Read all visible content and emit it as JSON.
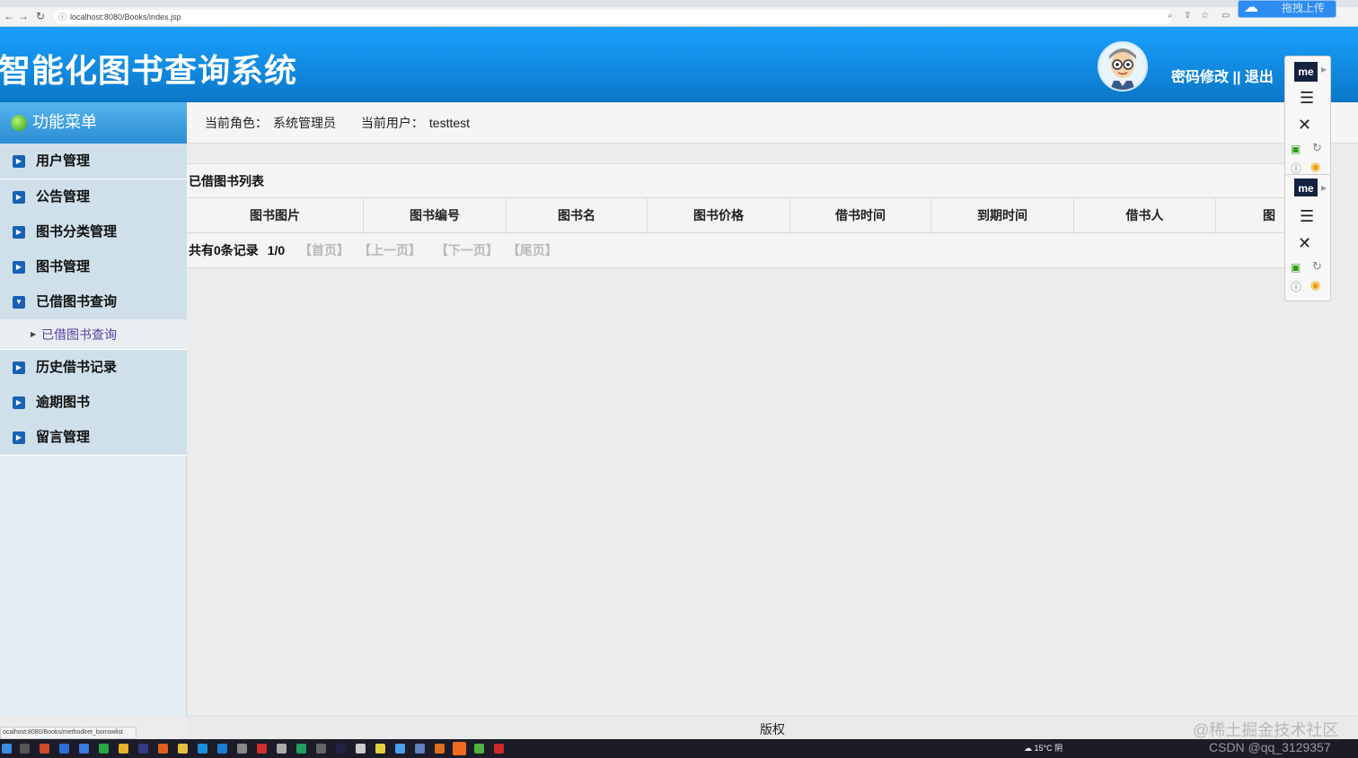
{
  "browser": {
    "url": "localhost:8080/Books/index.jsp",
    "status_url": "ocalhost:8080/Books/methodlret_borrowlist",
    "baidu_upload": "拖拽上传"
  },
  "header": {
    "title": "智能化图书查询系统",
    "change_password": "密码修改",
    "separator": "||",
    "logout": "退出"
  },
  "sidebar": {
    "title": "功能菜单",
    "items": [
      {
        "label": "用户管理"
      },
      {
        "label": "公告管理"
      },
      {
        "label": "图书分类管理"
      },
      {
        "label": "图书管理"
      },
      {
        "label": "已借图书查询"
      },
      {
        "label": "历史借书记录"
      },
      {
        "label": "逾期图书"
      },
      {
        "label": "留言管理"
      }
    ],
    "sub_item": "已借图书查询"
  },
  "info": {
    "role_label": "当前角色：",
    "role_value": "系统管理员",
    "user_label": "当前用户：",
    "user_value": "testtest"
  },
  "main": {
    "section_title": "已借图书列表",
    "columns": [
      "图书图片",
      "图书编号",
      "图书名",
      "图书价格",
      "借书时间",
      "到期时间",
      "借书人",
      "图书"
    ],
    "pager": {
      "count_text": "共有0条记录",
      "page_text": "1/0",
      "first": "【首页】",
      "prev": "【上一页】",
      "next": "【下一页】",
      "last": "【尾页】"
    }
  },
  "footer": {
    "copyright": "版权"
  },
  "extension": {
    "logo": "me"
  },
  "watermark": "@稀土掘金技术社区",
  "taskbar": {
    "weather": "15°C 阴",
    "csdn": "CSDN @qq_3129357"
  }
}
